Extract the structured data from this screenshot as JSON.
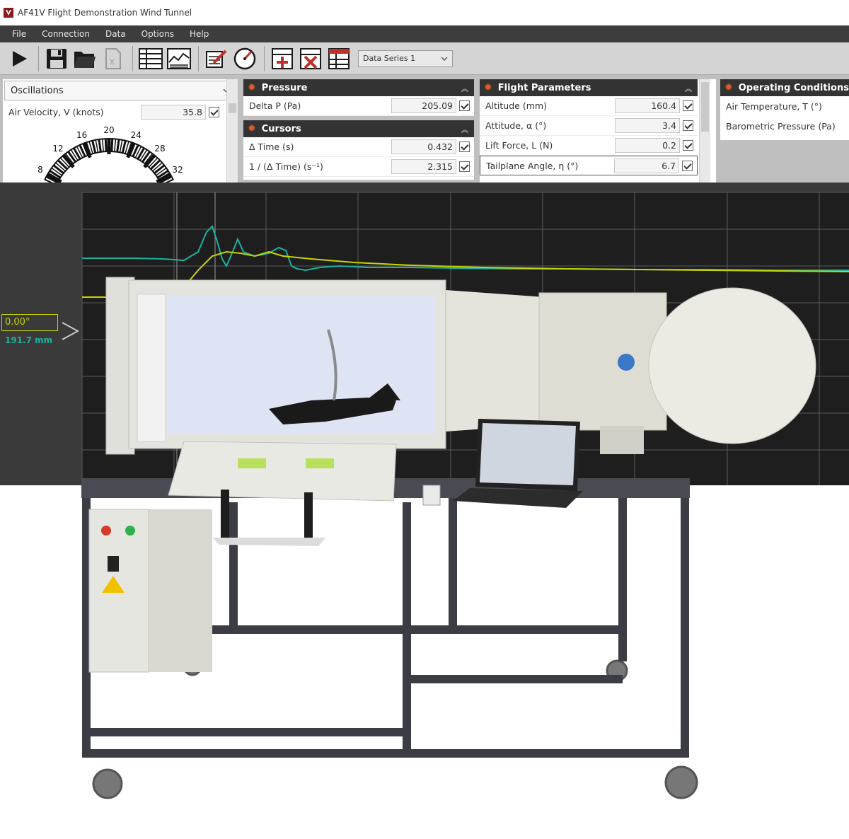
{
  "window": {
    "title": "AF41V Flight Demonstration Wind Tunnel"
  },
  "menu": [
    "File",
    "Connection",
    "Data",
    "Options",
    "Help"
  ],
  "toolbar": {
    "series_selected": "Data Series 1",
    "icons": [
      "play-icon",
      "save-icon",
      "open-folder-icon",
      "export-icon",
      "table-view-icon",
      "graph-view-icon",
      "edit-icon",
      "gauge-icon",
      "add-row-icon",
      "delete-icon",
      "table-settings-icon"
    ]
  },
  "oscillations": {
    "select_label": "Oscillations",
    "velocity_label": "Air Velocity, V (knots)",
    "velocity_value": "35.8",
    "dial_ticks": [
      "8",
      "12",
      "16",
      "20",
      "24",
      "28",
      "32"
    ]
  },
  "pressure": {
    "title": "Pressure",
    "rows": [
      {
        "label": "Delta P (Pa)",
        "value": "205.09"
      }
    ]
  },
  "cursors": {
    "title": "Cursors",
    "rows": [
      {
        "label": "Δ Time (s)",
        "value": "0.432"
      },
      {
        "label": "1 / (Δ Time) (s⁻¹)",
        "value": "2.315"
      }
    ]
  },
  "flight": {
    "title": "Flight Parameters",
    "rows": [
      {
        "label": "Altitude (mm)",
        "value": "160.4"
      },
      {
        "label": "Attitude, α (°)",
        "value": "3.4"
      },
      {
        "label": "Lift Force, L (N)",
        "value": "0.2"
      },
      {
        "label": "Tailplane Angle, η (°)",
        "value": "6.7"
      }
    ]
  },
  "operating": {
    "title": "Operating Conditions",
    "rows": [
      {
        "label": "Air Temperature, T (°)"
      },
      {
        "label": "Barometric Pressure (Pa)"
      }
    ]
  },
  "cursor_readout": {
    "angle": "0.00°",
    "altitude": "191.7 mm"
  },
  "colors": {
    "titlebar": "#ffffff",
    "menubar": "#3d3d3d",
    "toolbar": "#d4d4d4",
    "panel_header": "#333333",
    "gear": "#e05a2a",
    "chart_bg": "#3a3a3a",
    "series_teal": "#19b3a0",
    "series_yellow": "#c9d400"
  }
}
